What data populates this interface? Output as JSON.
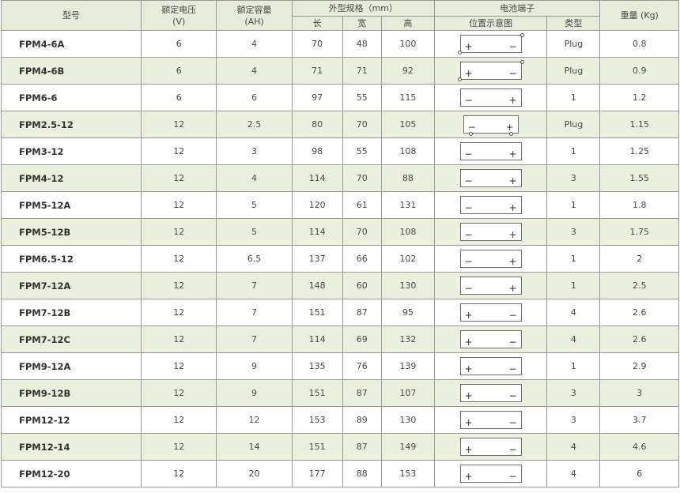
{
  "header": {
    "model": "型号",
    "voltage": "额定电压",
    "voltage_unit": "(V)",
    "capacity": "额定容量",
    "capacity_unit": "(AH)",
    "dimensions": "外型规格（mm）",
    "length": "长",
    "width": "宽",
    "height": "高",
    "terminal": "电池端子",
    "position": "位置示意图",
    "type": "类型",
    "weight": "重量 (Kg)"
  },
  "rows": [
    {
      "model": "FPM4-6A",
      "voltage": "6",
      "capacity": "4",
      "length": "70",
      "width": "48",
      "height": "100",
      "type": "Plug",
      "weight": "0.8",
      "diagram": {
        "left": "+",
        "right": "−",
        "dots": "corners"
      }
    },
    {
      "model": "FPM4-6B",
      "voltage": "6",
      "capacity": "4",
      "length": "71",
      "width": "71",
      "height": "92",
      "type": "Plug",
      "weight": "0.9",
      "diagram": {
        "left": "+",
        "right": "−",
        "dots": "corners"
      }
    },
    {
      "model": "FPM6-6",
      "voltage": "6",
      "capacity": "6",
      "length": "97",
      "width": "55",
      "height": "115",
      "type": "1",
      "weight": "1.2",
      "diagram": {
        "left": "−",
        "right": "+",
        "dots": "none"
      }
    },
    {
      "model": "FPM2.5-12",
      "voltage": "12",
      "capacity": "2.5",
      "length": "80",
      "width": "70",
      "height": "105",
      "type": "Plug",
      "weight": "1.15",
      "diagram": {
        "left": "−",
        "right": "+",
        "dots": "bottom"
      }
    },
    {
      "model": "FPM3-12",
      "voltage": "12",
      "capacity": "3",
      "length": "98",
      "width": "55",
      "height": "108",
      "type": "1",
      "weight": "1.25",
      "diagram": {
        "left": "−",
        "right": "+",
        "dots": "none"
      }
    },
    {
      "model": "FPM4-12",
      "voltage": "12",
      "capacity": "4",
      "length": "114",
      "width": "70",
      "height": "88",
      "type": "3",
      "weight": "1.55",
      "diagram": {
        "left": "−",
        "right": "+",
        "dots": "none"
      }
    },
    {
      "model": "FPM5-12A",
      "voltage": "12",
      "capacity": "5",
      "length": "120",
      "width": "61",
      "height": "131",
      "type": "1",
      "weight": "1.8",
      "diagram": {
        "left": "−",
        "right": "+",
        "dots": "none"
      }
    },
    {
      "model": "FPM5-12B",
      "voltage": "12",
      "capacity": "5",
      "length": "114",
      "width": "70",
      "height": "108",
      "type": "3",
      "weight": "1.75",
      "diagram": {
        "left": "−",
        "right": "+",
        "dots": "none"
      }
    },
    {
      "model": "FPM6.5-12",
      "voltage": "12",
      "capacity": "6.5",
      "length": "137",
      "width": "66",
      "height": "102",
      "type": "1",
      "weight": "2",
      "diagram": {
        "left": "−",
        "right": "+",
        "dots": "none"
      }
    },
    {
      "model": "FPM7-12A",
      "voltage": "12",
      "capacity": "7",
      "length": "148",
      "width": "60",
      "height": "130",
      "type": "1",
      "weight": "2.5",
      "diagram": {
        "left": "−",
        "right": "+",
        "dots": "none"
      }
    },
    {
      "model": "FPM7-12B",
      "voltage": "12",
      "capacity": "7",
      "length": "151",
      "width": "87",
      "height": "95",
      "type": "4",
      "weight": "2.6",
      "diagram": {
        "left": "+",
        "right": "−",
        "dots": "none"
      }
    },
    {
      "model": "FPM7-12C",
      "voltage": "12",
      "capacity": "7",
      "length": "114",
      "width": "69",
      "height": "132",
      "type": "4",
      "weight": "2.6",
      "diagram": {
        "left": "+",
        "right": "−",
        "dots": "none"
      }
    },
    {
      "model": "FPM9-12A",
      "voltage": "12",
      "capacity": "9",
      "length": "135",
      "width": "76",
      "height": "139",
      "type": "1",
      "weight": "2.9",
      "diagram": {
        "left": "+",
        "right": "−",
        "dots": "none"
      }
    },
    {
      "model": "FPM9-12B",
      "voltage": "12",
      "capacity": "9",
      "length": "151",
      "width": "87",
      "height": "107",
      "type": "3",
      "weight": "3",
      "diagram": {
        "left": "+",
        "right": "−",
        "dots": "none"
      }
    },
    {
      "model": "FPM12-12",
      "voltage": "12",
      "capacity": "12",
      "length": "153",
      "width": "89",
      "height": "130",
      "type": "3",
      "weight": "3.7",
      "diagram": {
        "left": "+",
        "right": "−",
        "dots": "none"
      }
    },
    {
      "model": "FPM12-14",
      "voltage": "12",
      "capacity": "14",
      "length": "151",
      "width": "87",
      "height": "149",
      "type": "4",
      "weight": "4.6",
      "diagram": {
        "left": "+",
        "right": "−",
        "dots": "none"
      }
    },
    {
      "model": "FPM12-20",
      "voltage": "12",
      "capacity": "20",
      "length": "177",
      "width": "88",
      "height": "153",
      "type": "4",
      "weight": "6",
      "diagram": {
        "left": "+",
        "right": "−",
        "dots": "none"
      }
    }
  ]
}
